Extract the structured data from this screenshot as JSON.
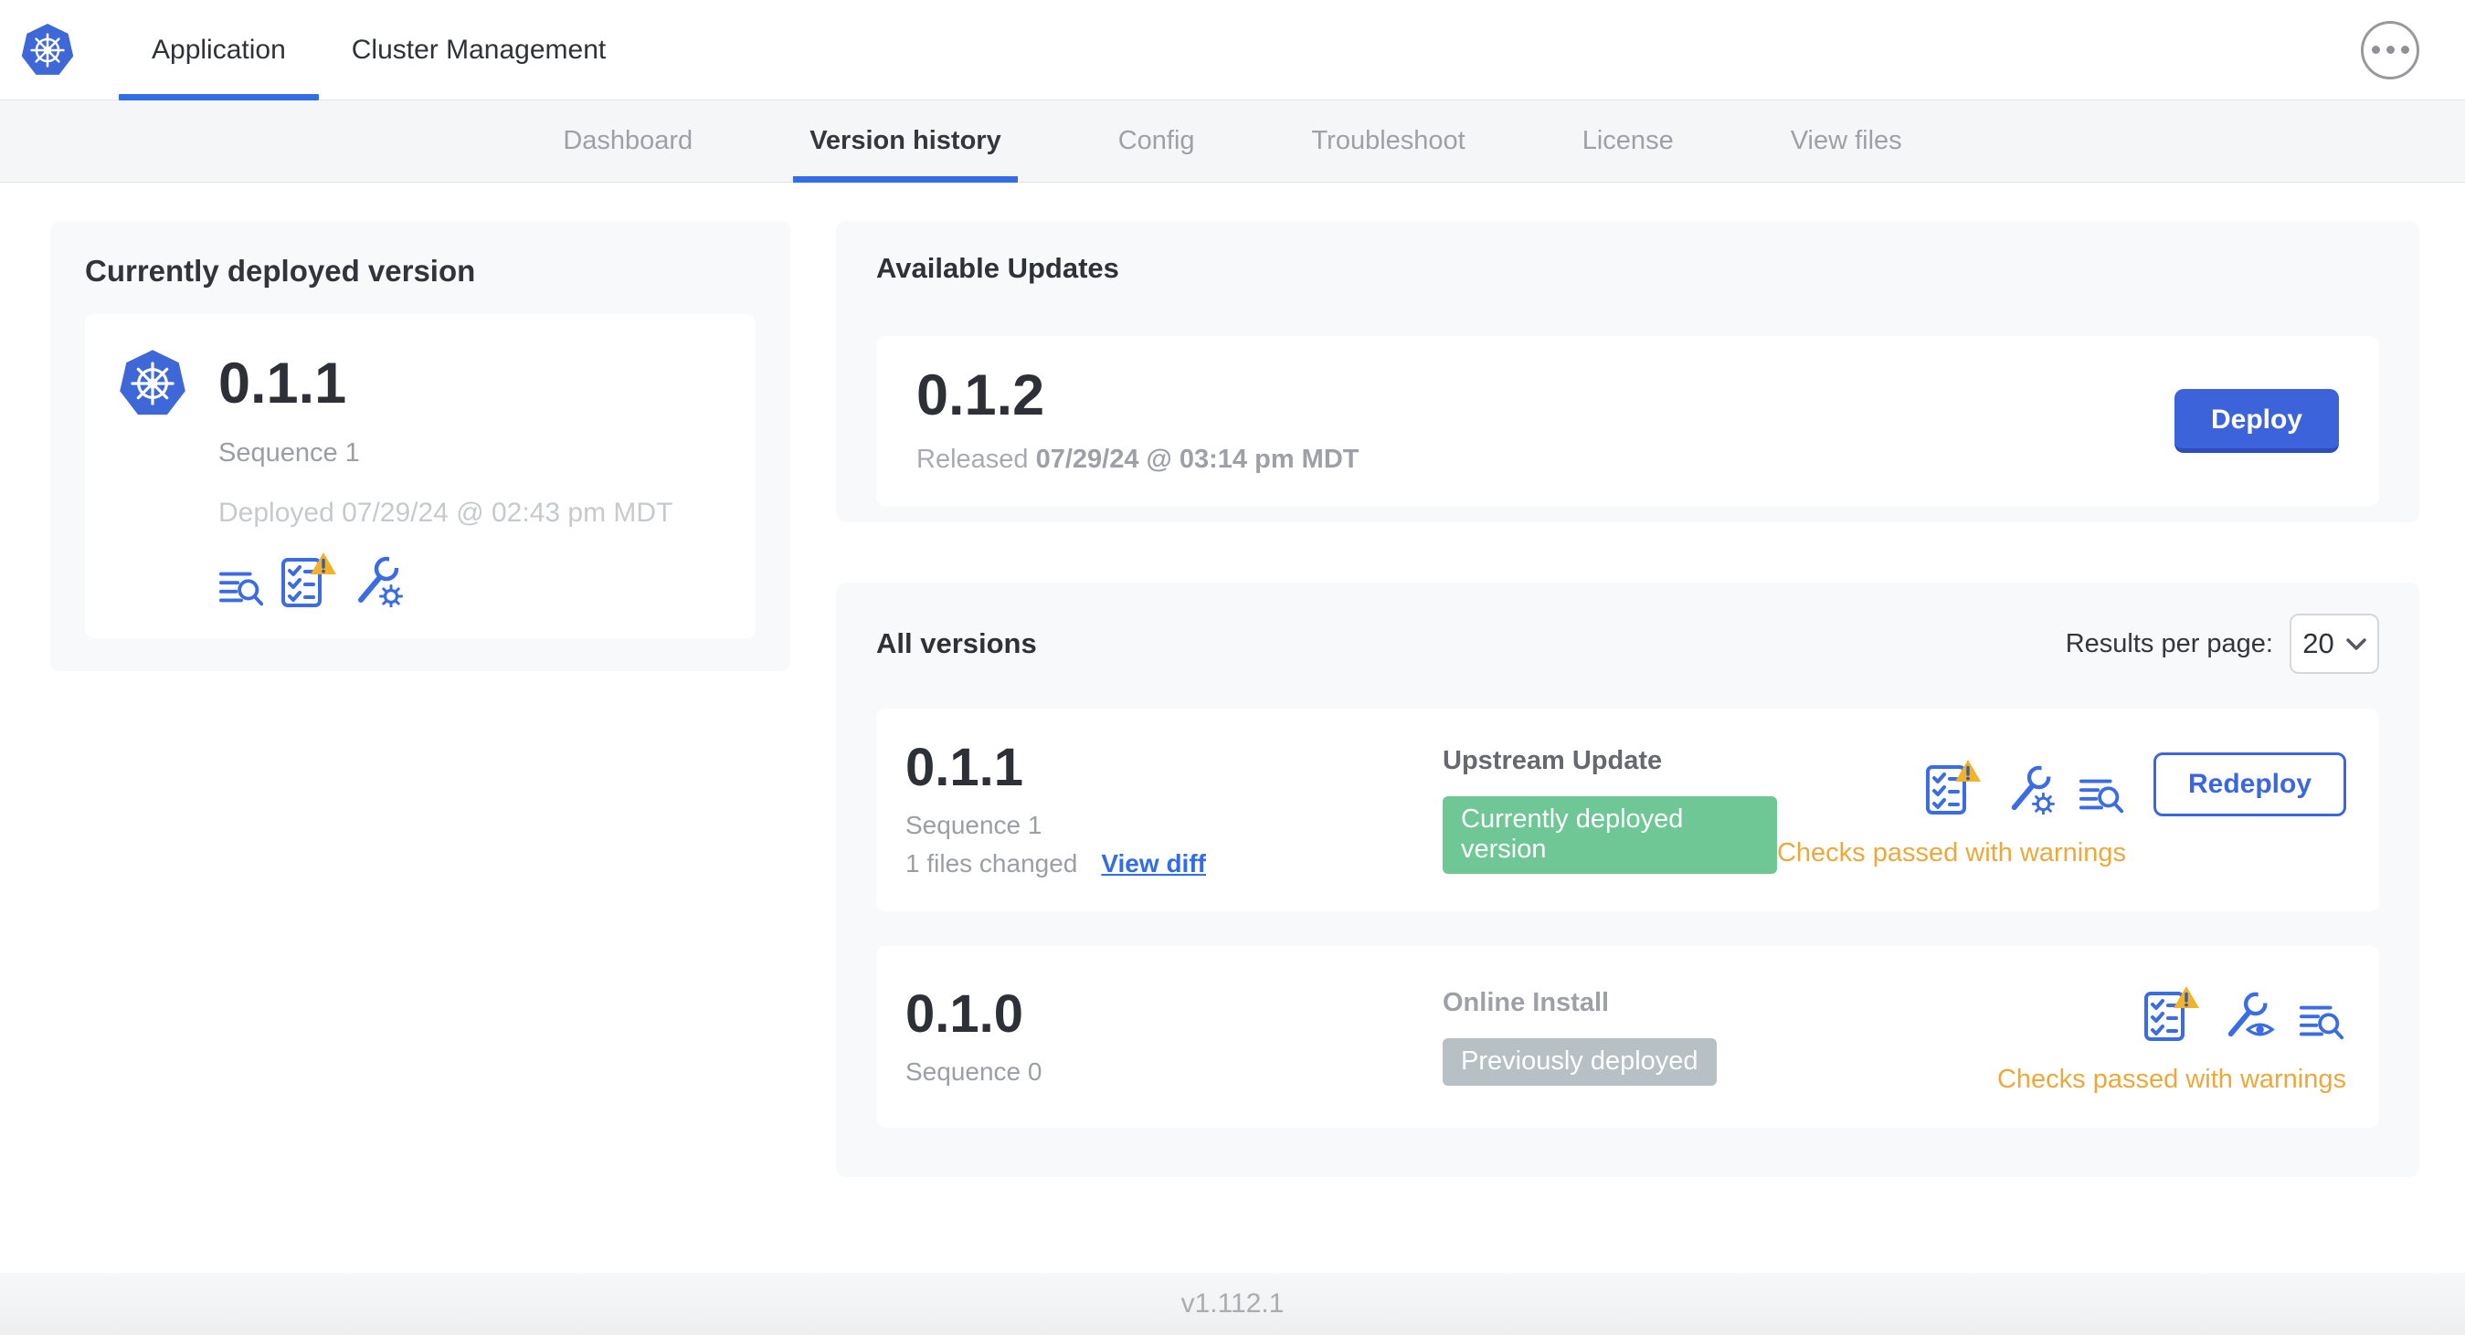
{
  "colors": {
    "accent_blue": "#326de6",
    "icon_blue": "#3b6ce2",
    "button_blue": "#3d63da",
    "warning_amber": "#eca93b",
    "warning_triangle": "#f0b32a",
    "badge_green": "#6ec795",
    "badge_gray": "#b7c0c5"
  },
  "header": {
    "logo_icon": "kubernetes-logo",
    "tabs": [
      {
        "label": "Application",
        "active": true
      },
      {
        "label": "Cluster Management",
        "active": false
      }
    ],
    "more_icon": "ellipsis-icon"
  },
  "subnav": {
    "items": [
      {
        "label": "Dashboard",
        "active": false
      },
      {
        "label": "Version history",
        "active": true
      },
      {
        "label": "Config",
        "active": false
      },
      {
        "label": "Troubleshoot",
        "active": false
      },
      {
        "label": "License",
        "active": false
      },
      {
        "label": "View files",
        "active": false
      }
    ]
  },
  "current_version": {
    "title": "Currently deployed version",
    "app_icon": "kubernetes-logo",
    "version": "0.1.1",
    "sequence": "Sequence 1",
    "deployed": "Deployed 07/29/24 @ 02:43 pm MDT",
    "icons": [
      "diff-logs-icon",
      "preflight-checks-warning-icon",
      "edit-config-icon"
    ]
  },
  "available_updates": {
    "title": "Available Updates",
    "version": "0.1.2",
    "released_label": "Released",
    "released_date": "07/29/24 @ 03:14 pm MDT",
    "deploy_label": "Deploy"
  },
  "all_versions": {
    "title": "All versions",
    "results_per_page_label": "Results per page:",
    "results_per_page_value": "20",
    "rows": [
      {
        "version": "0.1.1",
        "sequence": "Sequence 1",
        "files_changed": "1 files changed",
        "view_diff_label": "View diff",
        "source": "Upstream Update",
        "badge": "Currently deployed version",
        "badge_color": "green",
        "icons": [
          "preflight-checks-warning-icon",
          "edit-config-icon",
          "diff-logs-icon"
        ],
        "action_label": "Redeploy",
        "status": "Checks passed with warnings"
      },
      {
        "version": "0.1.0",
        "sequence": "Sequence 0",
        "source": "Online Install",
        "badge": "Previously deployed",
        "badge_color": "gray",
        "icons": [
          "preflight-checks-warning-icon",
          "view-config-icon",
          "diff-logs-icon"
        ],
        "status": "Checks passed with warnings"
      }
    ]
  },
  "footer": {
    "version": "v1.112.1"
  }
}
